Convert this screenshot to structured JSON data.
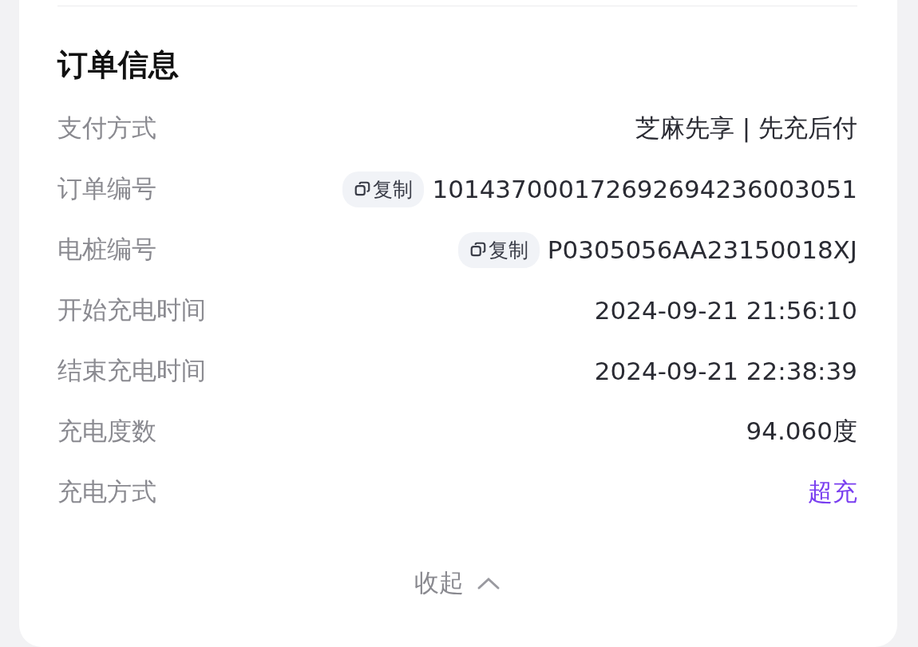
{
  "section": {
    "title": "订单信息"
  },
  "rows": [
    {
      "label": "支付方式",
      "value": "芝麻先享 | 先充后付",
      "kind": "text"
    },
    {
      "label": "订单编号",
      "value": "101437000172692694236003051",
      "kind": "copy",
      "action": "复制"
    },
    {
      "label": "电桩编号",
      "value": "P0305056AA23150018XJ",
      "kind": "copy",
      "action": "复制"
    },
    {
      "label": "开始充电时间",
      "value": "2024-09-21 21:56:10",
      "kind": "text"
    },
    {
      "label": "结束充电时间",
      "value": "2024-09-21 22:38:39",
      "kind": "text"
    },
    {
      "label": "充电度数",
      "value": "94.060度",
      "kind": "text"
    },
    {
      "label": "充电方式",
      "value": "超充",
      "kind": "accent"
    }
  ],
  "collapse": {
    "label": "收起"
  }
}
